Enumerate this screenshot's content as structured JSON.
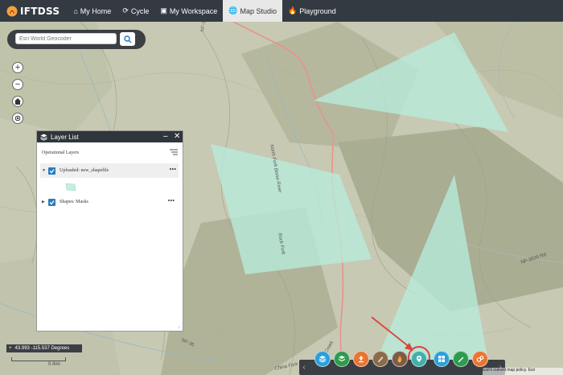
{
  "app": {
    "name": "IFTDSS"
  },
  "nav": [
    {
      "label": "My Home",
      "icon": "home-icon"
    },
    {
      "label": "Cycle",
      "icon": "cycle-icon"
    },
    {
      "label": "My Workspace",
      "icon": "folder-icon"
    },
    {
      "label": "Map Studio",
      "icon": "globe-icon",
      "active": true
    },
    {
      "label": "Playground",
      "icon": "flame-icon"
    }
  ],
  "search": {
    "placeholder": "Esri World Geocoder"
  },
  "map": {
    "road_labels": [
      "NF-351 Rd",
      "NF-3626 Rd",
      "NF-35",
      "North Fork Boise River",
      "China Fork",
      "Creek",
      "Rock Fork"
    ]
  },
  "layer_list": {
    "title": "Layer List",
    "section_label": "Operational Layers",
    "layers": [
      {
        "name": "Uploaded: new_shapefile",
        "checked": true,
        "expanded": true
      },
      {
        "name": "Shapes: Masks",
        "checked": true,
        "expanded": false
      }
    ]
  },
  "coordinates": "43.993 -115.537 Degrees",
  "scale": "0.4mi",
  "attribution": "Esri's current map policy. Esri",
  "colors": {
    "topbar": "#333a42",
    "accent": "#2a7bbf",
    "mask": "#b7ecdc",
    "road": "#e8938a"
  },
  "toolbar": {
    "tools": [
      {
        "name": "layers-tool",
        "color": "#2b9fd9"
      },
      {
        "name": "basemap-tool",
        "color": "#2e9b4e"
      },
      {
        "name": "upload-tool",
        "color": "#e87533"
      },
      {
        "name": "landscape-tool",
        "color": "#8a6b4b"
      },
      {
        "name": "fire-tool",
        "color": "#7a5c48"
      },
      {
        "name": "marker-tool",
        "color": "#43b0aa",
        "highlighted": true
      },
      {
        "name": "grid-tool",
        "color": "#2b9fd9"
      },
      {
        "name": "edit-tool",
        "color": "#2e9b4e"
      },
      {
        "name": "analysis-tool",
        "color": "#e87533"
      }
    ]
  }
}
